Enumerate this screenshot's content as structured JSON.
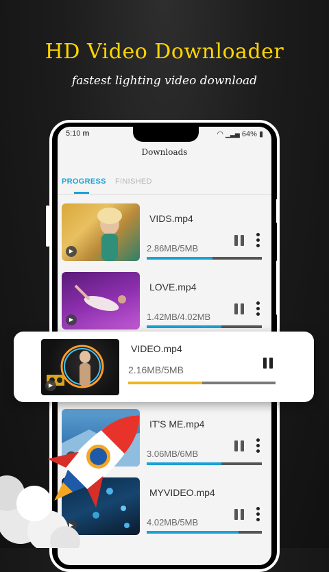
{
  "headline": "HD Video Downloader",
  "subline": "fastest lighting video download",
  "status_bar": {
    "time": "5:10",
    "carrier_icon": "m",
    "battery": "64%"
  },
  "screen_title": "Downloads",
  "tabs": [
    {
      "label": "PROGRESS",
      "active": true
    },
    {
      "label": "FINISHED",
      "active": false
    }
  ],
  "downloads": [
    {
      "name": "VIDS.mp4",
      "size": "2.86MB/5MB",
      "progress": 0.57
    },
    {
      "name": "LOVE.mp4",
      "size": "1.42MB/4.02MB",
      "progress": 0.65
    },
    {
      "name": "IT'S ME.mp4",
      "size": "3.06MB/6MB",
      "progress": 0.65
    },
    {
      "name": "MYVIDEO.mp4",
      "size": "4.02MB/5MB",
      "progress": 0.8
    }
  ],
  "highlighted": {
    "name": "VIDEO.mp4",
    "size": "2.16MB/5MB",
    "progress": 0.5
  },
  "colors": {
    "accent": "#1aa1d6",
    "headline": "#ffd400",
    "highlight_bar": "#f2b51c"
  }
}
